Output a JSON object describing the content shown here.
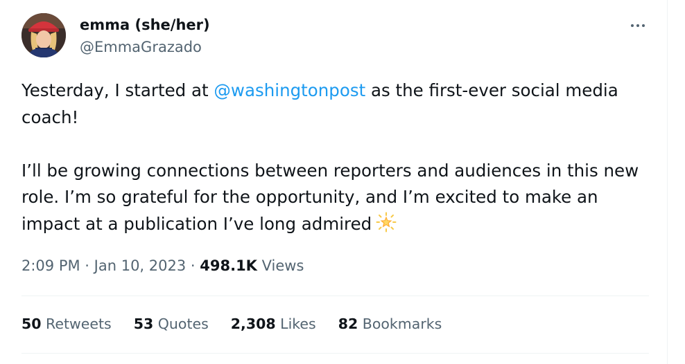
{
  "user": {
    "display_name": "emma (she/her)",
    "handle": "@EmmaGrazado"
  },
  "tweet": {
    "text_before_mention": "Yesterday, I started at ",
    "mention": "@washingtonpost",
    "text_after_mention": " as the first-ever social media coach!",
    "paragraph2": "I’ll be growing connections between reporters and audiences in this new role. I’m so grateful for the opportunity, and I’m excited to make an impact at a publication I’ve long admired",
    "emoji": "glowing-star-icon"
  },
  "meta": {
    "time": "2:09 PM",
    "separator": " · ",
    "date": "Jan 10, 2023",
    "views_count": "498.1K",
    "views_label": " Views"
  },
  "stats": {
    "retweets": {
      "count": "50",
      "label": " Retweets"
    },
    "quotes": {
      "count": "53",
      "label": " Quotes"
    },
    "likes": {
      "count": "2,308",
      "label": " Likes"
    },
    "bookmarks": {
      "count": "82",
      "label": " Bookmarks"
    }
  },
  "colors": {
    "accent": "#1d9bf0",
    "text": "#0f1419",
    "secondary": "#536471",
    "divider": "#eff3f4"
  }
}
